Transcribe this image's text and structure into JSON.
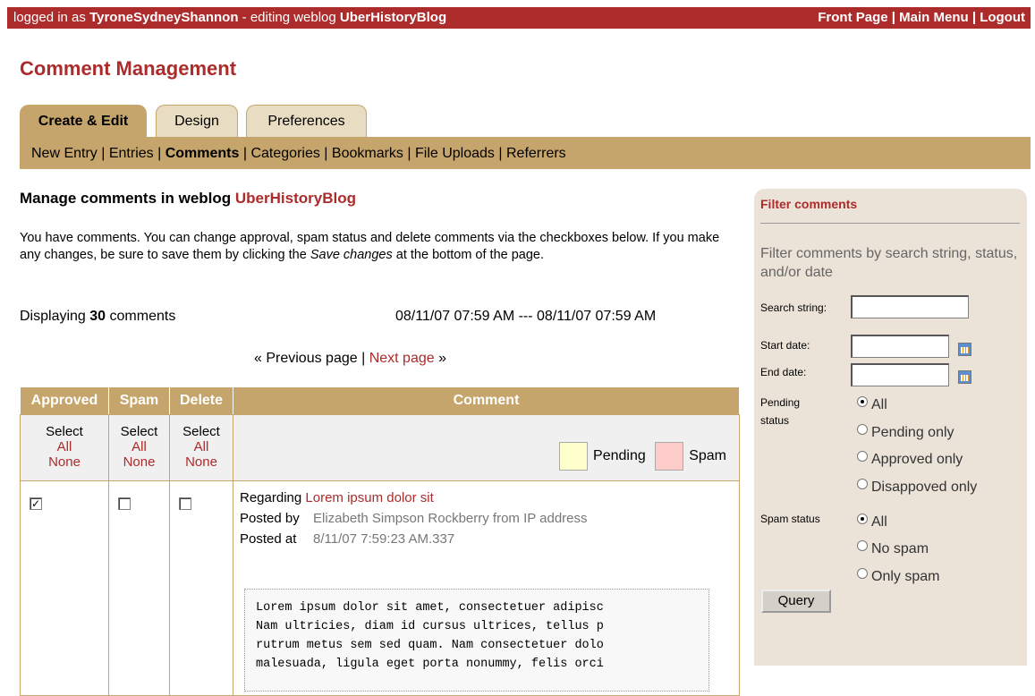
{
  "topbar": {
    "logged_prefix": "logged in as",
    "username": "TyroneSydneyShannon",
    "editing_prefix": "- editing weblog",
    "weblog": "UberHistoryBlog",
    "links": [
      "Front Page",
      "Main Menu",
      "Logout"
    ],
    "separator": "|",
    "bg_color": "#ac2b2b"
  },
  "page_title": "Comment Management",
  "tabs": [
    {
      "label": "Create & Edit",
      "active": true
    },
    {
      "label": "Design",
      "active": false
    },
    {
      "label": "Preferences",
      "active": false
    }
  ],
  "subnav": [
    "New Entry",
    "Entries",
    "Comments",
    "Categories",
    "Bookmarks",
    "File Uploads",
    "Referrers"
  ],
  "subnav_current": "Comments",
  "main": {
    "heading_prefix": "Manage comments in weblog",
    "heading_blog": "UberHistoryBlog",
    "intro_1": "You have comments. You can change approval, spam status and delete comments via the checkboxes below. If you make any changes, be sure to save them by clicking the",
    "intro_em": "Save changes",
    "intro_2": "at the bottom of the page.",
    "count_prefix": "Displaying",
    "count": "30",
    "count_suffix": "comments",
    "date_range": "08/11/07 07:59 AM --- 08/11/07 07:59 AM",
    "prev": "« Previous page",
    "pager_sep": "|",
    "next": "Next page",
    "next_arrow": "»"
  },
  "table": {
    "headers": [
      "Approved",
      "Spam",
      "Delete",
      "Comment"
    ],
    "select_label": "Select",
    "all_label": "All",
    "none_label": "None",
    "legend": [
      {
        "label": "Pending",
        "color": "#ffffcc"
      },
      {
        "label": "Spam",
        "color": "#ffcccc"
      }
    ],
    "comment": {
      "approved": true,
      "spam": false,
      "delete": false,
      "regarding_label": "Regarding",
      "regarding": "Lorem ipsum dolor sit",
      "posted_by_label": "Posted by",
      "posted_by": "Elizabeth Simpson Rockberry from IP address",
      "posted_at_label": "Posted at",
      "posted_at": "8/11/07 7:59:23 AM.337",
      "body_lines": [
        "Lorem ipsum dolor sit amet, consectetuer adipisc",
        "Nam ultricies, diam id cursus ultrices, tellus p",
        "rutrum metus sem sed quam. Nam consectetuer dolo",
        "malesuada, ligula eget porta nonummy, felis orci"
      ]
    }
  },
  "filter": {
    "title": "Filter comments",
    "desc": "Filter comments by search string, status, and/or date",
    "search_label": "Search string:",
    "start_label": "Start date:",
    "end_label": "End date:",
    "pending_label": "Pending status",
    "pending_options": [
      "All",
      "Pending only",
      "Approved only",
      "Disappoved only"
    ],
    "pending_selected": "All",
    "spam_label": "Spam status",
    "spam_options": [
      "All",
      "No spam",
      "Only spam"
    ],
    "spam_selected": "All",
    "query_button": "Query",
    "calendar_icon": "calendar-icon"
  }
}
